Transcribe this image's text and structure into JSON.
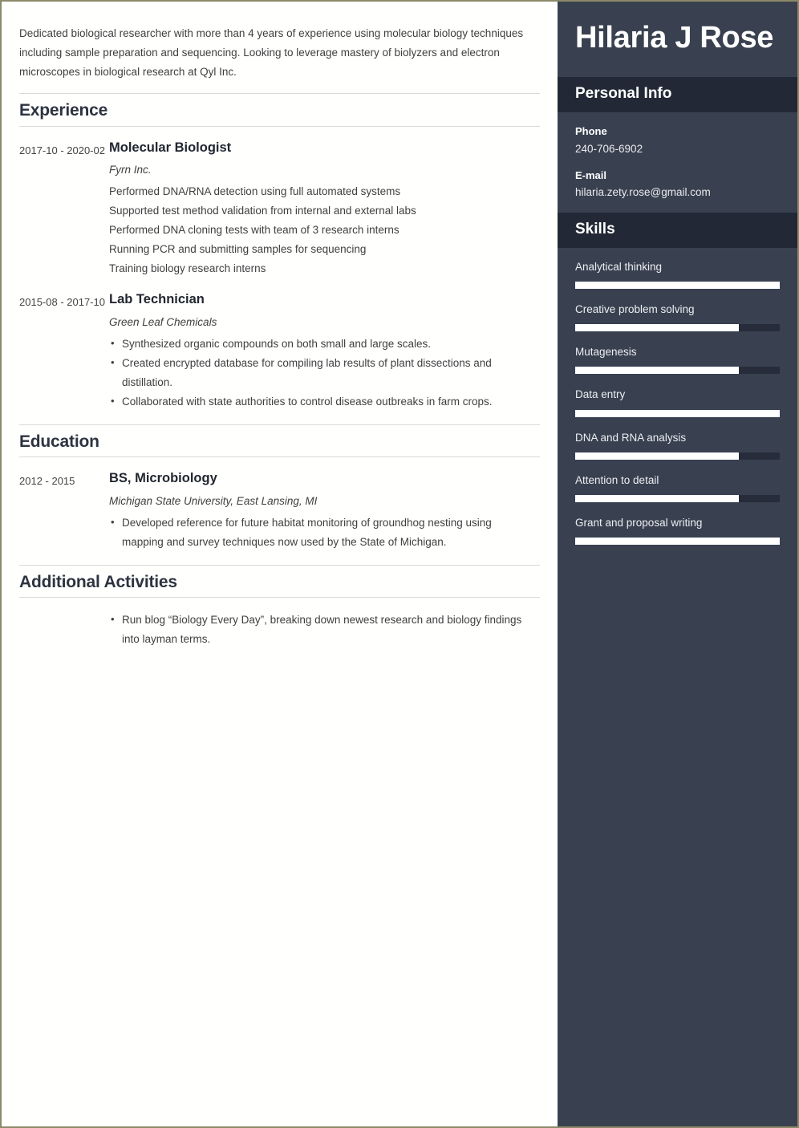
{
  "document": {
    "type": "resume",
    "summary": "Dedicated biological researcher with more than 4 years of experience using molecular biology techniques including sample preparation and sequencing. Looking to leverage mastery of biolyzers and electron microscopes in biological research at Qyl Inc."
  },
  "sidebar": {
    "name": "Hilaria J Rose",
    "personal_info": {
      "heading": "Personal Info",
      "fields": [
        {
          "label": "Phone",
          "value": "240-706-6902"
        },
        {
          "label": "E-mail",
          "value": "hilaria.zety.rose@gmail.com"
        }
      ]
    },
    "skills": {
      "heading": "Skills",
      "items": [
        {
          "name": "Analytical thinking",
          "level": 100
        },
        {
          "name": "Creative problem solving",
          "level": 80
        },
        {
          "name": "Mutagenesis",
          "level": 80
        },
        {
          "name": "Data entry",
          "level": 100
        },
        {
          "name": "DNA and RNA analysis",
          "level": 80
        },
        {
          "name": "Attention to detail",
          "level": 80
        },
        {
          "name": "Grant and proposal writing",
          "level": 100
        }
      ]
    }
  },
  "sections": {
    "experience": {
      "title": "Experience",
      "entries": [
        {
          "dates": "2017-10 - 2020-02",
          "title": "Molecular Biologist",
          "subtitle": "Fyrn Inc.",
          "bulleted": false,
          "points": [
            "Performed DNA/RNA detection using full automated systems",
            "Supported test method validation from internal and external labs",
            "Performed DNA cloning tests with team of 3 research interns",
            "Running PCR and submitting samples for sequencing",
            "Training biology research interns"
          ]
        },
        {
          "dates": "2015-08 - 2017-10",
          "title": "Lab Technician",
          "subtitle": "Green Leaf Chemicals",
          "bulleted": true,
          "points": [
            "Synthesized organic compounds on both small and large scales.",
            "Created encrypted database for compiling lab results of plant dissections and distillation.",
            "Collaborated with state authorities to control disease outbreaks in farm crops."
          ]
        }
      ]
    },
    "education": {
      "title": "Education",
      "entries": [
        {
          "dates": "2012 - 2015",
          "title": "BS, Microbiology",
          "subtitle": "Michigan State University, East Lansing, MI",
          "bulleted": true,
          "points": [
            "Developed reference for future habitat monitoring of groundhog nesting using mapping and survey techniques now used by the State of Michigan."
          ]
        }
      ]
    },
    "additional_activities": {
      "title": "Additional Activities",
      "points": [
        "Run blog “Biology Every Day”, breaking down newest research and biology findings into layman terms."
      ]
    }
  },
  "colors": {
    "sidebar_bg": "#394150",
    "sidebar_band": "#222835",
    "skill_track": "#262c3a",
    "skill_fill": "#ffffff",
    "page_border": "#8c8a6a",
    "heading_text": "#2e3340",
    "body_text": "#3f3f3f"
  }
}
